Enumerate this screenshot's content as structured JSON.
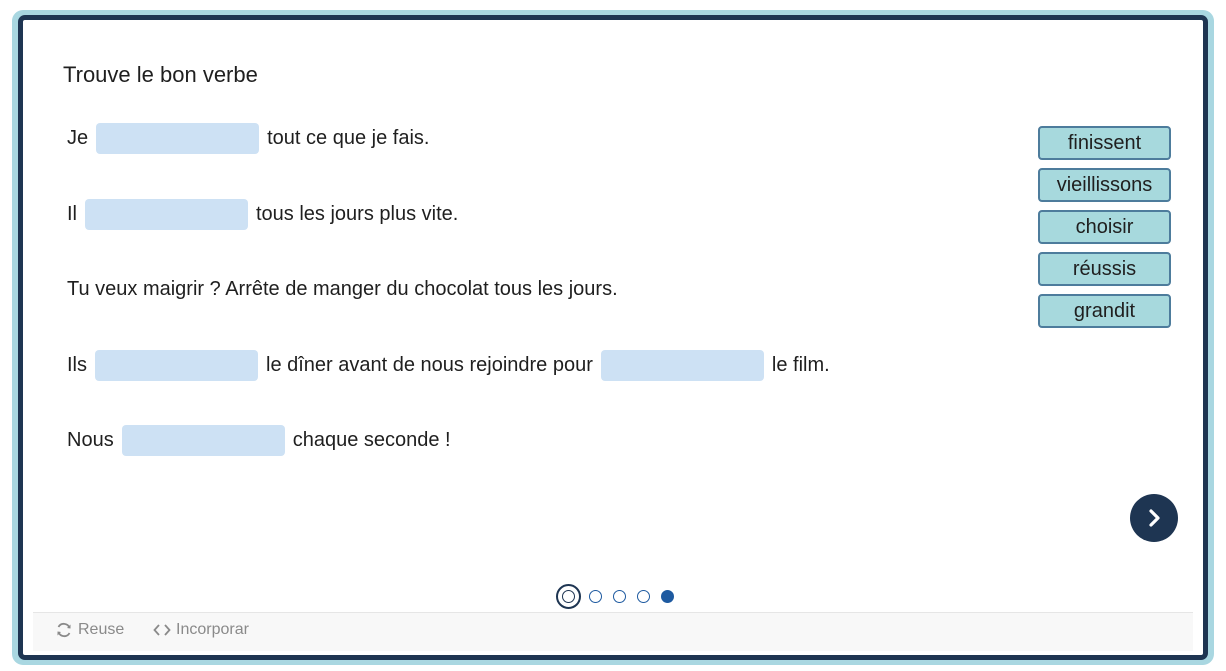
{
  "title": "Trouve le bon verbe",
  "sentences": [
    {
      "parts": [
        "Je",
        "tout ce que je fais."
      ]
    },
    {
      "parts": [
        "Il",
        "tous les jours plus vite."
      ]
    },
    {
      "parts": [
        "Tu veux maigrir ? Arrête de manger du chocolat tous les jours."
      ]
    },
    {
      "parts": [
        "Ils",
        "le dîner avant de nous rejoindre pour",
        "le film."
      ]
    },
    {
      "parts": [
        "Nous",
        "chaque seconde !"
      ]
    }
  ],
  "word_bank": [
    "finissent",
    "vieillissons",
    "choisir",
    "réussis",
    "grandit"
  ],
  "pagination": {
    "total": 5,
    "current_index": 0,
    "filled_index": 4
  },
  "footer": {
    "reuse_label": "Reuse",
    "embed_label": "Incorporar"
  },
  "colors": {
    "accent": "#1e3552",
    "blank": "#cde1f4",
    "word_bg": "#a7d9dd",
    "frame_outer": "#a9d7e1"
  }
}
